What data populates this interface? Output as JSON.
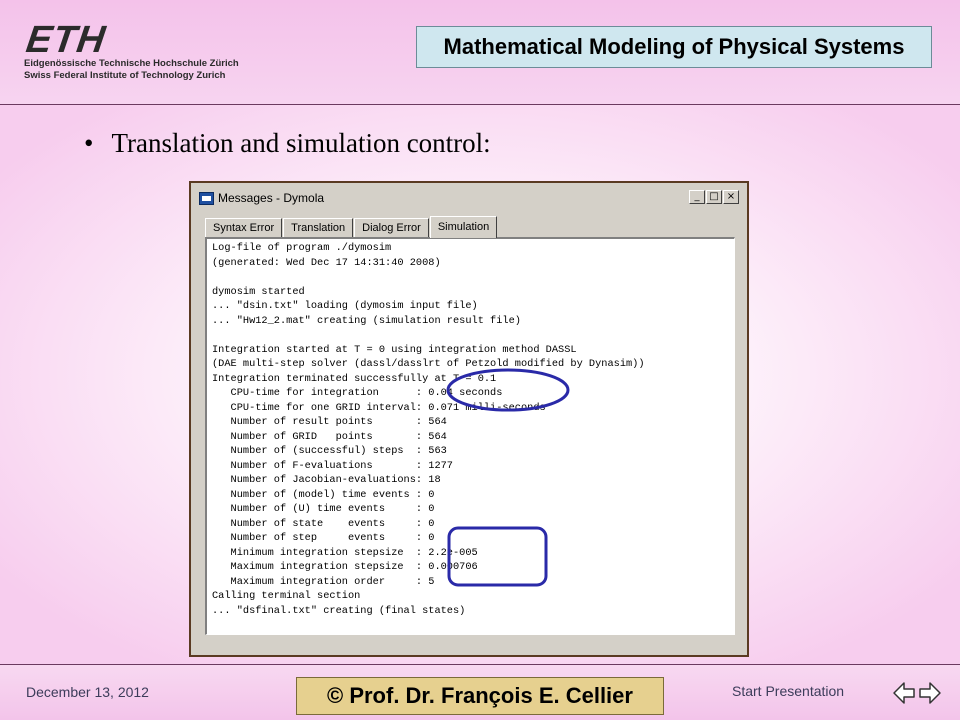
{
  "header": {
    "logo_mark": "ETH",
    "logo_line1": "Eidgenössische Technische Hochschule Zürich",
    "logo_line2": "Swiss Federal Institute of Technology Zurich",
    "title": "Mathematical Modeling of Physical Systems"
  },
  "content": {
    "bullet_symbol": "•",
    "bullet_text": "Translation and simulation control:"
  },
  "window": {
    "title": "Messages - Dymola",
    "buttons": {
      "minimize": "_",
      "maximize": "□",
      "close": "×"
    },
    "tabs": [
      {
        "label": "Syntax Error",
        "active": false
      },
      {
        "label": "Translation",
        "active": false
      },
      {
        "label": "Dialog Error",
        "active": false
      },
      {
        "label": "Simulation",
        "active": true
      }
    ],
    "log_lines": [
      "Log-file of program ./dymosim",
      "(generated: Wed Dec 17 14:31:40 2008)",
      "",
      "dymosim started",
      "... \"dsin.txt\" loading (dymosim input file)",
      "... \"Hw12_2.mat\" creating (simulation result file)",
      "",
      "Integration started at T = 0 using integration method DASSL",
      "(DAE multi-step solver (dassl/dasslrt of Petzold modified by Dynasim))",
      "Integration terminated successfully at T = 0.1",
      "   CPU-time for integration      : 0.04 seconds",
      "   CPU-time for one GRID interval: 0.071 milli-seconds",
      "   Number of result points       : 564",
      "   Number of GRID   points       : 564",
      "   Number of (successful) steps  : 563",
      "   Number of F-evaluations       : 1277",
      "   Number of Jacobian-evaluations: 18",
      "   Number of (model) time events : 0",
      "   Number of (U) time events     : 0",
      "   Number of state    events     : 0",
      "   Number of step     events     : 0",
      "   Minimum integration stepsize  : 2.2e-005",
      "   Maximum integration stepsize  : 0.000706",
      "   Maximum integration order     : 5",
      "Calling terminal section",
      "... \"dsfinal.txt\" creating (final states)"
    ]
  },
  "annotation_color": "#2a2aa8",
  "footer": {
    "date": "December 13, 2012",
    "copyright": "© Prof. Dr. François E. Cellier",
    "start_link": "Start Presentation",
    "nav_icons": [
      "arrow-left-icon",
      "arrow-right-icon"
    ]
  }
}
